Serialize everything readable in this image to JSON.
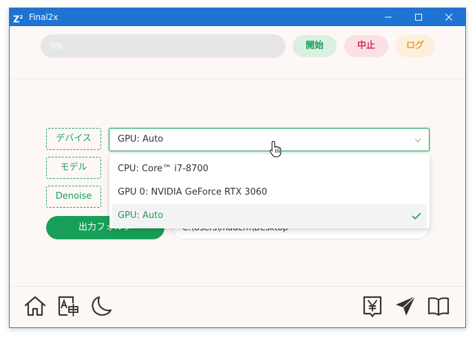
{
  "window": {
    "title": "Final2x",
    "app_icon_text": "Z",
    "app_icon_sup": "2"
  },
  "toolbar": {
    "progress_text": "0%",
    "progress_value": 0,
    "start_label": "開始",
    "stop_label": "中止",
    "log_label": "ログ"
  },
  "settings": {
    "device_tag": "デバイス",
    "model_tag": "モデル",
    "denoise_tag": "Denoise",
    "device_selected": "GPU: Auto",
    "device_options": [
      "CPU: Core™ i7-8700",
      "GPU 0: NVIDIA GeForce RTX 3060",
      "GPU: Auto"
    ],
    "output_button": "出力フォルダ",
    "output_path": "C:\\Users\\madem\\Desktop"
  },
  "footer": {
    "left_icons": [
      "home-icon",
      "language-icon",
      "moon-icon"
    ],
    "right_icons": [
      "yen-icon",
      "send-icon",
      "book-icon"
    ]
  },
  "colors": {
    "accent": "#18a058",
    "titlebar": "#1f73d2",
    "stop": "#d03050",
    "log": "#f0a020"
  }
}
